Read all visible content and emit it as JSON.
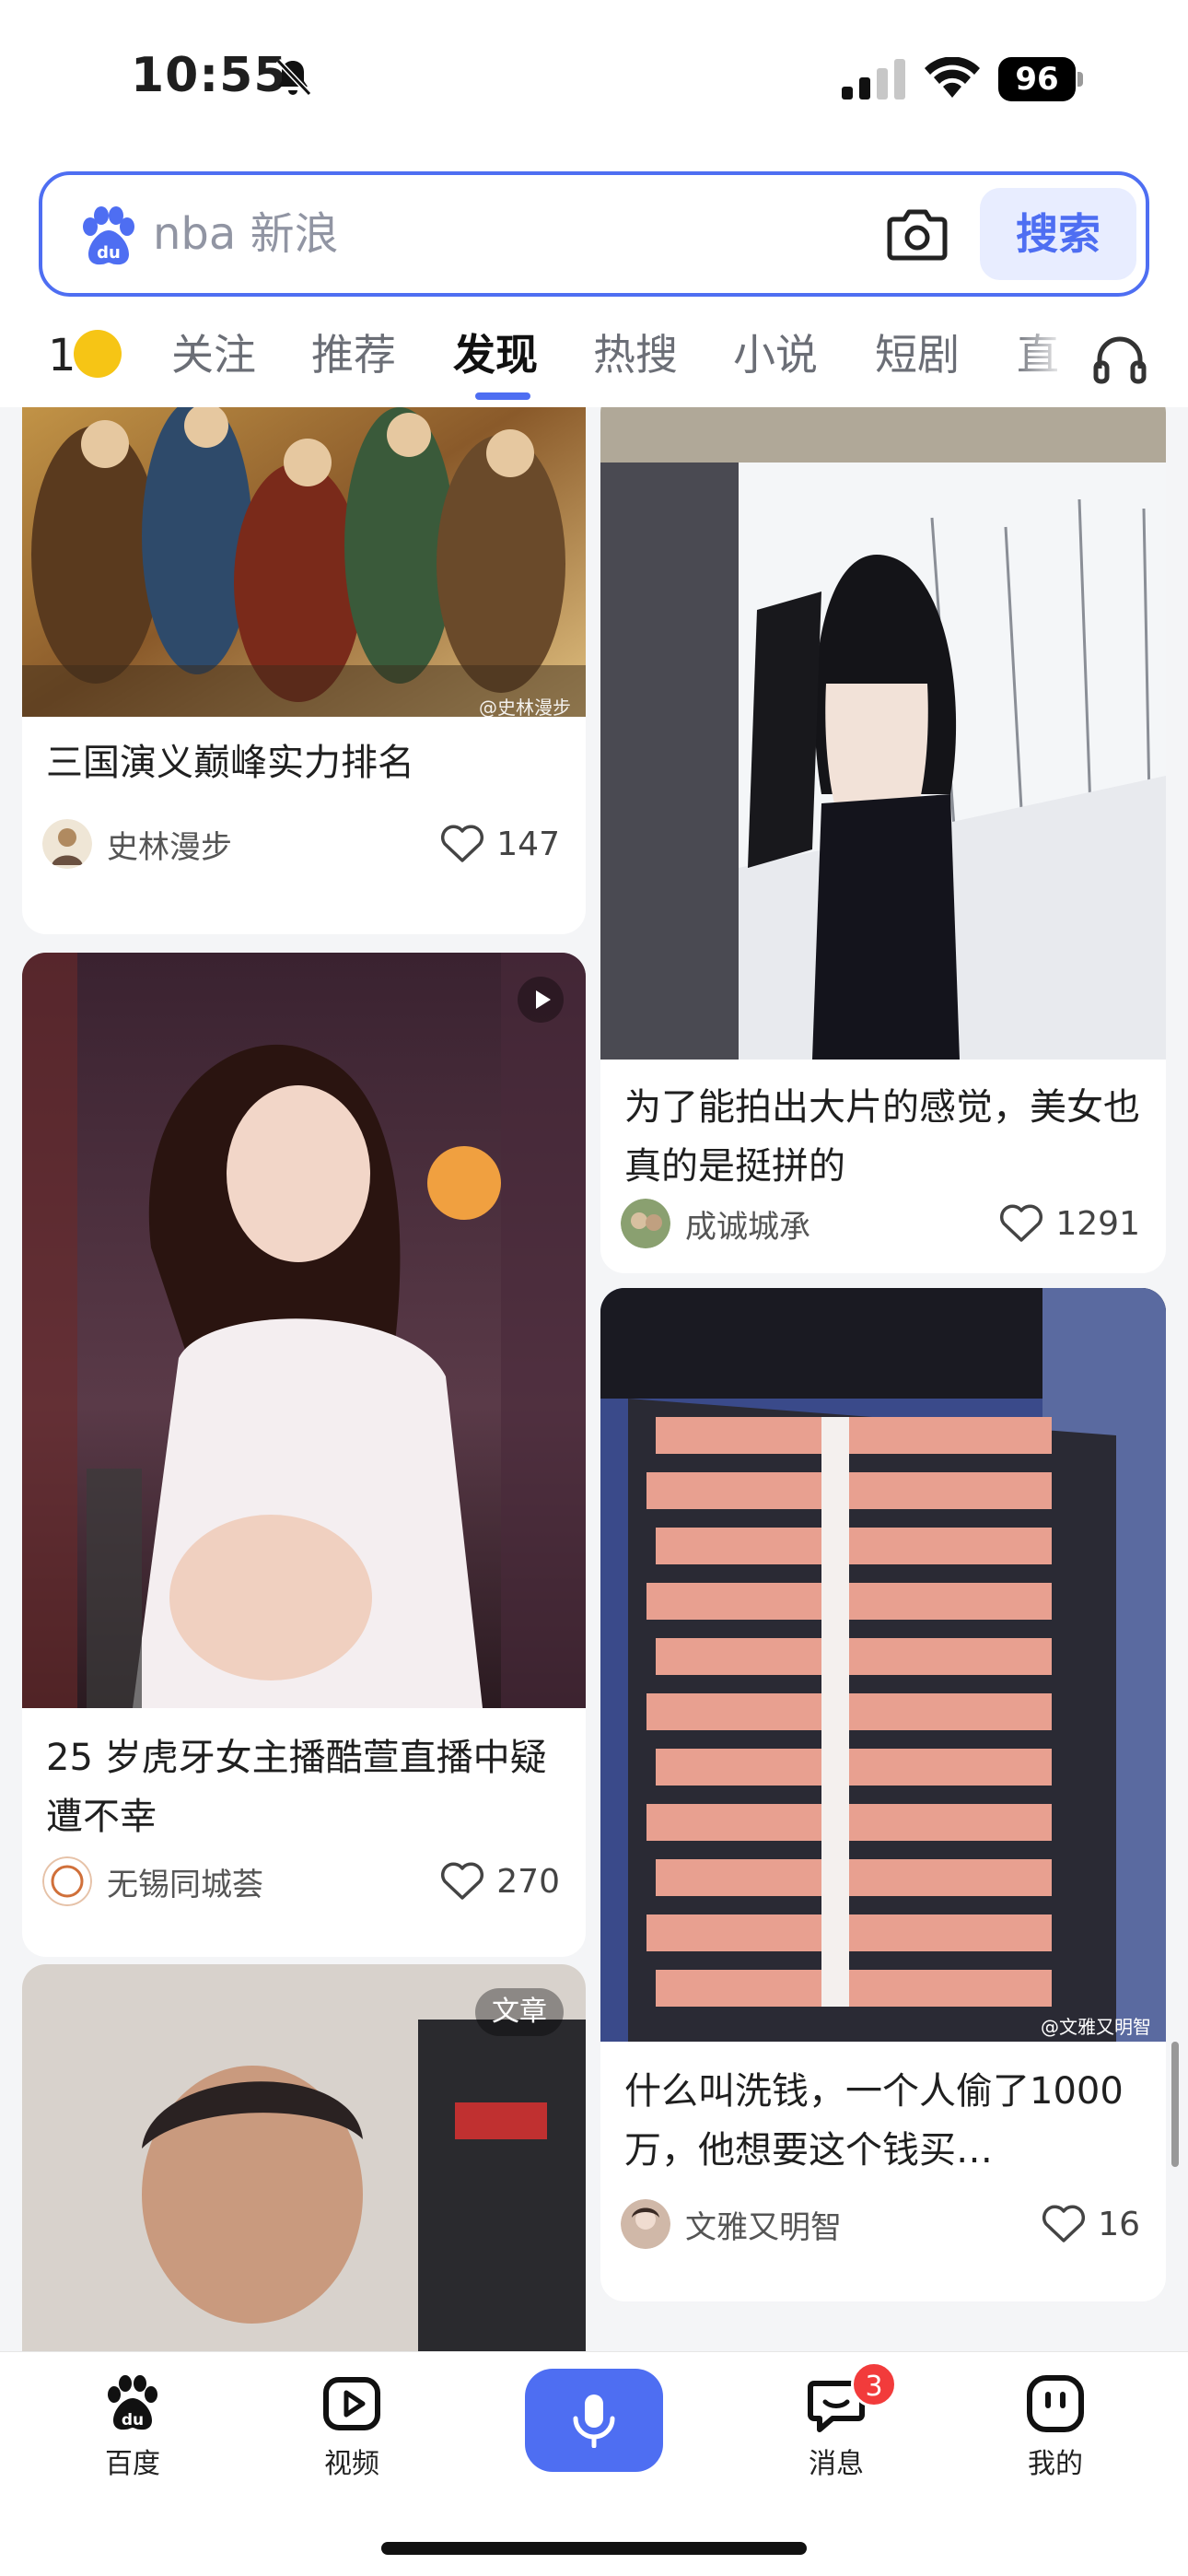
{
  "status": {
    "time": "10:55",
    "battery": "96"
  },
  "search": {
    "query": "nba 新浪",
    "button": "搜索"
  },
  "tabs": {
    "weather": "1°",
    "items": [
      "关注",
      "推荐",
      "发现",
      "热搜",
      "小说",
      "短剧",
      "直"
    ],
    "active": "发现"
  },
  "feed": {
    "left": [
      {
        "title": "三国演义巅峰实力排名",
        "author": "史林漫步",
        "likes": "147",
        "watermark": "@史林漫步"
      },
      {
        "title": "25 岁虎牙女主播酷萱直播中疑遭不幸",
        "author": "无锡同城荟",
        "likes": "270",
        "badge": "video"
      },
      {
        "badge_text": "文章"
      }
    ],
    "right": [
      {
        "title": "为了能拍出大片的感觉，美女也真的是挺拼的",
        "author": "成诚城承",
        "likes": "1291"
      },
      {
        "title": "什么叫洗钱，一个人偷了1000 万，他想要这个钱买…",
        "author": "文雅又明智",
        "likes": "16",
        "watermark": "@文雅又明智"
      }
    ]
  },
  "nav": {
    "home": "百度",
    "video": "视频",
    "messages": "消息",
    "messages_badge": "3",
    "me": "我的"
  },
  "colors": {
    "accent": "#4e6ef2",
    "badge": "#f23b3b"
  }
}
